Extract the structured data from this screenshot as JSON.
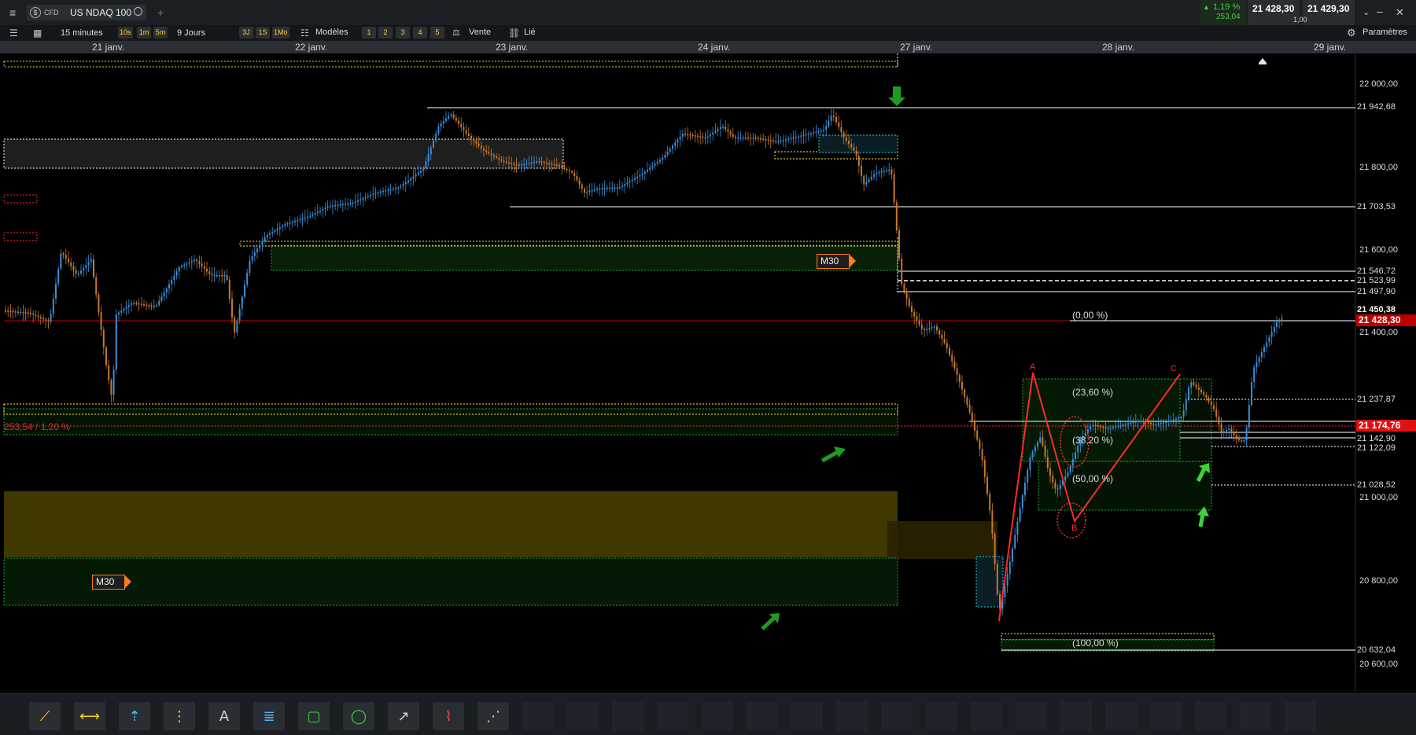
{
  "header": {
    "menu_icon": "menu-icon",
    "instrument_badge": "CFD",
    "instrument_name": "US NDAQ 100",
    "change_pct": "1,19 %",
    "change_pts": "253,04",
    "bid": "21 428,30",
    "ask": "21 429,30",
    "spread": "1,00"
  },
  "toolbar": {
    "timeframe": "15 minutes",
    "intervals": [
      "10s",
      "1m",
      "5m"
    ],
    "range": "9 Jours",
    "ranges": [
      "3J",
      "1S",
      "1Mo"
    ],
    "templates_label": "Modèles",
    "template_slots": [
      "1",
      "2",
      "3",
      "4",
      "5"
    ],
    "sell_label": "Vente",
    "linked_label": "Lié",
    "settings_label": "Paramètres"
  },
  "dates": [
    "21 janv.",
    "22 janv.",
    "23 janv.",
    "24 janv.",
    "27 janv.",
    "28 janv.",
    "29 janv."
  ],
  "price_axis": {
    "ticks": [
      "22 000,00",
      "21 800,00",
      "21 600,00",
      "21 400,00",
      "21 000,00",
      "20 800,00",
      "20 600,00"
    ],
    "level_labels": [
      "21 942,68",
      "21 703,53",
      "21 546,72",
      "21 523,99",
      "21 497,90",
      "21 450,38",
      "21 237,87",
      "21 142,90",
      "21 122,09",
      "21 028,52",
      "20 632,04"
    ],
    "current_price": "21 428,30",
    "current_price_color": "#c00000",
    "red_level": "21 174,76"
  },
  "annotations": {
    "change_label": "253,54 / 1,20 %",
    "timeframe_tags": [
      "M30",
      "M30"
    ],
    "fib_labels": [
      "(0,00 %)",
      "(23,60 %)",
      "(38,20 %)",
      "(50,00 %)",
      "(100,00 %)"
    ],
    "wave_labels": [
      "A",
      "B",
      "C"
    ]
  },
  "colors": {
    "up_candle": "#3a8fd8",
    "down_candle": "#c8782a",
    "yellow_zone": "#fff23a",
    "green_zone": "#1fae2b",
    "accent_orange": "#ff7a1a",
    "fib_line": "#ff2a2a"
  },
  "drawing_tools": [
    "trend-line-tool",
    "horizontal-line-tool",
    "price-range-tool",
    "vertical-line-tool",
    "text-tool",
    "fibonacci-tool",
    "rectangle-tool",
    "ellipse-tool",
    "arrow-tool",
    "path-tool",
    "multi-point-tool"
  ]
}
